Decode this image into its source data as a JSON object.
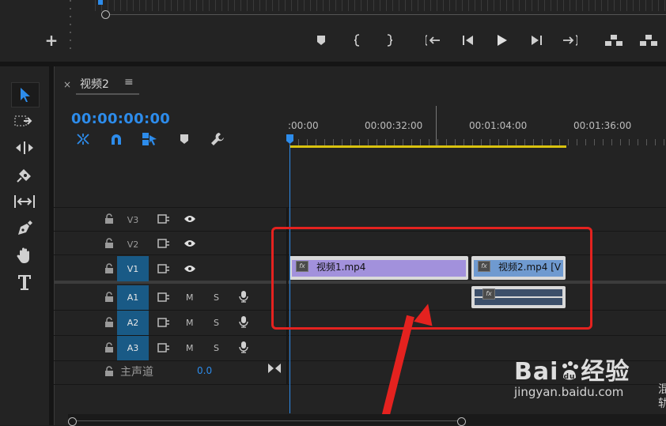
{
  "top_panel": {
    "add_button_label": "+",
    "transport": [
      "add-marker",
      "mark-in",
      "mark-out",
      "go-to-in",
      "step-back",
      "play",
      "step-forward",
      "go-to-out",
      "lift",
      "extract"
    ]
  },
  "tools": [
    "selection-tool",
    "track-select-tool",
    "ripple-edit-tool",
    "razor-tool",
    "slip-tool",
    "pen-tool",
    "hand-tool",
    "type-tool"
  ],
  "sequence": {
    "close_label": "×",
    "tab_title": "视频2",
    "menu_label": "≡",
    "timecode": "00:00:00:00"
  },
  "ruler": {
    "labels": [
      ":00:00",
      "00:00:32:00",
      "00:01:04:00",
      "00:01:36:00"
    ]
  },
  "tracks": {
    "video": [
      {
        "name": "V3",
        "selected": false
      },
      {
        "name": "V2",
        "selected": false
      },
      {
        "name": "V1",
        "selected": true
      }
    ],
    "audio": [
      {
        "name": "A1",
        "m": "M",
        "s": "S"
      },
      {
        "name": "A2",
        "m": "M",
        "s": "S"
      },
      {
        "name": "A3",
        "m": "M",
        "s": "S"
      }
    ],
    "master": {
      "label": "主声道",
      "value": "0.0"
    }
  },
  "clips": {
    "v1_clip1": {
      "fx": "fx",
      "name": "视频1.mp4",
      "color": "#a291dc"
    },
    "v1_clip2": {
      "fx": "fx",
      "name": "视频2.mp4 [V",
      "color": "#6f9ad0"
    },
    "a1_clip": {
      "fx": "fx",
      "color": "#3c4f6a"
    }
  },
  "watermark": {
    "brand": "Bai",
    "brand_cn": "经验",
    "url": "jingyan.baidu.com"
  },
  "edge_text": [
    "混",
    "轨"
  ],
  "colors": {
    "accent": "#2d8ceb",
    "annotation": "#e4221f",
    "workarea": "#d9c20f"
  }
}
